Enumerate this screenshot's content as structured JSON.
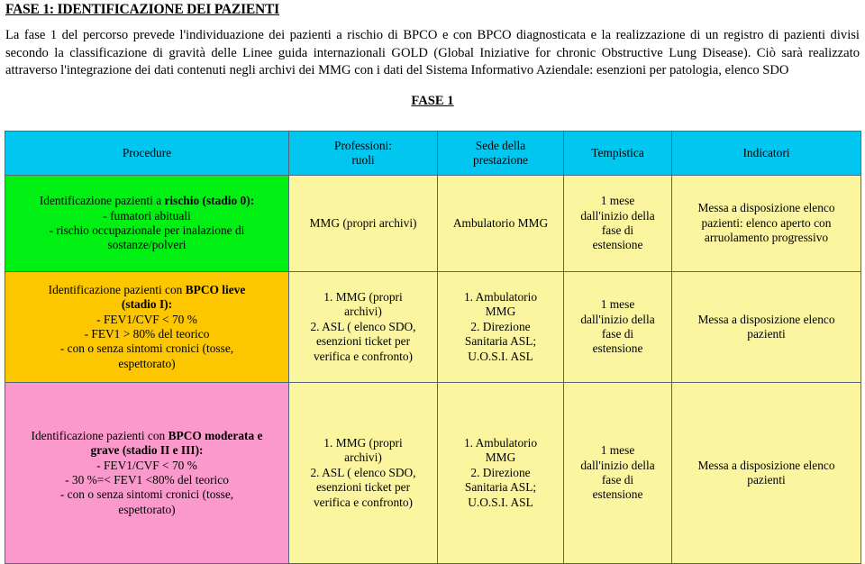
{
  "document": {
    "title": "FASE 1: IDENTIFICAZIONE DEI PAZIENTI",
    "intro_paragraph": "La fase 1 del percorso prevede l'individuazione dei pazienti a rischio di BPCO e con  BPCO diagnosticata e la realizzazione di un registro di pazienti divisi secondo la classificazione di gravità delle Linee guida internazionali GOLD (Global Iniziative for chronic Obstructive Lung Disease). Ciò sarà realizzato attraverso l'integrazione dei dati contenuti negli archivi dei MMG con i dati del Sistema Informativo Aziendale: esenzioni per patologia, elenco SDO",
    "phase_label": "FASE 1"
  },
  "colors": {
    "header_cyan": "#00c6f0",
    "row1_green": "#00f014",
    "row2_gold": "#fdc700",
    "row3_pink": "#fb99cc",
    "cell_yellow": "#fbf5a0",
    "border": "#50687a"
  },
  "table": {
    "headers": [
      {
        "line1": "Procedure",
        "line2": ""
      },
      {
        "line1": "Professioni:",
        "line2": "ruoli"
      },
      {
        "line1": "Sede della",
        "line2": "prestazione"
      },
      {
        "line1": "Tempistica",
        "line2": ""
      },
      {
        "line1": "Indicatori",
        "line2": ""
      }
    ],
    "rows": [
      {
        "accent": "green",
        "procedure": {
          "l1_plain": "Identificazione pazienti a ",
          "l1_bold": "rischio (stadio 0):",
          "l2": "- fumatori abituali",
          "l3": "- rischio occupazionale per inalazione di",
          "l4": "sostanze/polveri",
          "l5": "",
          "l6": ""
        },
        "professioni": {
          "l1": "MMG (propri archivi)",
          "l2": "",
          "l3": "",
          "l4": ""
        },
        "sede": {
          "l1": "Ambulatorio MMG",
          "l2": "",
          "l3": "",
          "l4": ""
        },
        "tempistica": {
          "l1": "1   mese",
          "l2": "dall'inizio della",
          "l3": "fase di",
          "l4": "estensione"
        },
        "indicatori": {
          "l1": "Messa a disposizione elenco",
          "l2": "pazienti: elenco aperto con",
          "l3": "arruolamento progressivo"
        }
      },
      {
        "accent": "gold",
        "procedure": {
          "l1_plain": "Identificazione pazienti con ",
          "l1_bold": "BPCO lieve",
          "l2": "(stadio I):",
          "l3": "- FEV1/CVF < 70 %",
          "l4": "- FEV1 > 80% del teorico",
          "l5": "- con o senza sintomi cronici (tosse,",
          "l6": "espettorato)"
        },
        "professioni": {
          "l1": "1. MMG (propri",
          "l2": "archivi)",
          "l3": "2. ASL ( elenco SDO,",
          "l4": "esenzioni ticket per",
          "l5": "verifica e confronto)"
        },
        "sede": {
          "l1": "1. Ambulatorio",
          "l2": "MMG",
          "l3": "2. Direzione",
          "l4": "Sanitaria ASL;",
          "l5": "U.O.S.I. ASL"
        },
        "tempistica": {
          "l1": "1   mese",
          "l2": "dall'inizio della",
          "l3": "fase di",
          "l4": "estensione"
        },
        "indicatori": {
          "l1": "Messa a disposizione elenco",
          "l2": "pazienti",
          "l3": ""
        }
      },
      {
        "accent": "pink",
        "procedure": {
          "l1_plain": "Identificazione pazienti con ",
          "l1_bold": "BPCO moderata e",
          "l2": "grave (stadio II e III):",
          "l3": "- FEV1/CVF < 70 %",
          "l4": "- 30 %=< FEV1 <80% del teorico",
          "l5": "- con o senza sintomi cronici (tosse,",
          "l6": "espettorato)"
        },
        "professioni": {
          "l1": "1. MMG (propri",
          "l2": "archivi)",
          "l3": "2. ASL ( elenco SDO,",
          "l4": "esenzioni ticket per",
          "l5": "verifica e confronto)"
        },
        "sede": {
          "l1": "1. Ambulatorio",
          "l2": "MMG",
          "l3": "2. Direzione",
          "l4": "Sanitaria ASL;",
          "l5": "U.O.S.I. ASL"
        },
        "tempistica": {
          "l1": "1   mese",
          "l2": "dall'inizio della",
          "l3": "fase di",
          "l4": "estensione"
        },
        "indicatori": {
          "l1": "Messa a disposizione elenco",
          "l2": "pazienti",
          "l3": ""
        }
      }
    ]
  }
}
